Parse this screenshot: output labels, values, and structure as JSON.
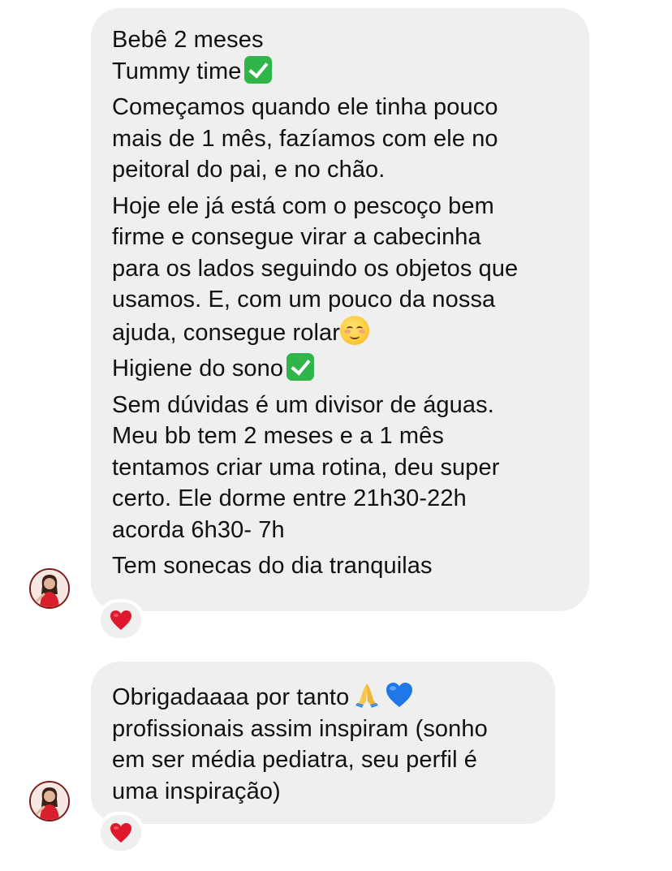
{
  "messages": [
    {
      "lines": [
        "Bebê 2 meses",
        "Tummy time",
        "Começamos quando ele tinha pouco",
        "mais de 1 mês, fazíamos com ele no",
        "peitoral do pai, e no chão.",
        "Hoje ele já está com o pescoço bem",
        "firme e consegue virar a cabecinha",
        "para os lados seguindo os objetos que",
        "usamos. E, com um pouco da nossa",
        "ajuda, consegue rolar",
        "Higiene do sono",
        "Sem dúvidas é um divisor de águas.",
        "Meu bb tem 2 meses e a 1 mês",
        "tentamos criar uma rotina, deu super",
        "certo. Ele dorme entre 21h30-22h",
        "acorda 6h30- 7h",
        "Tem sonecas do dia tranquilas"
      ],
      "inline_emojis": [
        "check-mark-button-icon",
        "smiling-face-icon",
        "check-mark-button-icon"
      ],
      "reaction": "red-heart-icon"
    },
    {
      "lines": [
        "Obrigadaaaa por tanto",
        "profissionais assim inspiram (sonho",
        "em ser média pediatra, seu perfil é",
        "uma inspiração)"
      ],
      "inline_emojis": [
        "folded-hands-icon",
        "blue-heart-icon"
      ],
      "reaction": "red-heart-icon"
    }
  ],
  "colors": {
    "bubble": "#efefef",
    "text": "#111111",
    "check_green": "#2fb54a",
    "heart_red": "#e0182d",
    "heart_blue": "#1f77e8",
    "avatar_dress": "#d7202b"
  }
}
